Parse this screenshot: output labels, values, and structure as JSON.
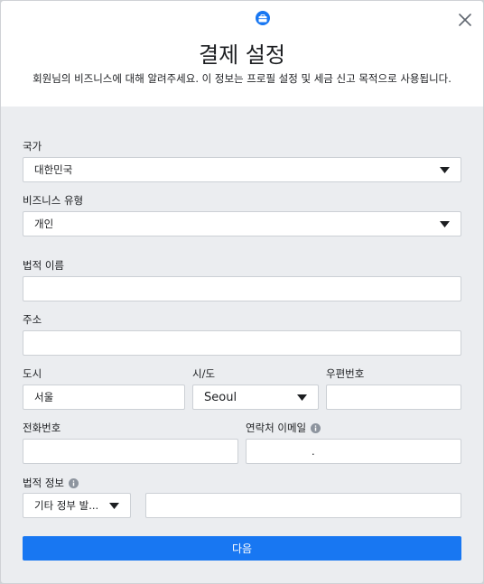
{
  "dialog": {
    "title": "결제 설정",
    "subtitle": "회원님의 비즈니스에 대해 알려주세요. 이 정보는 프로필 설정 및 세금 신고 목적으로 사용됩니다."
  },
  "form": {
    "country": {
      "label": "국가",
      "value": "대한민국"
    },
    "business_type": {
      "label": "비즈니스 유형",
      "value": "개인"
    },
    "legal_name": {
      "label": "법적 이름",
      "value": ""
    },
    "address": {
      "label": "주소",
      "value": ""
    },
    "city": {
      "label": "도시",
      "value": "서울"
    },
    "province": {
      "label": "시/도",
      "value": "Seoul"
    },
    "postal_code": {
      "label": "우편번호",
      "value": ""
    },
    "phone": {
      "label": "전화번호",
      "value": ""
    },
    "contact_email": {
      "label": "연락처 이메일",
      "value": "."
    },
    "legal_info": {
      "label": "법적 정보",
      "id_type": "기타 정부 발...",
      "value": ""
    }
  },
  "actions": {
    "next_label": "다음"
  },
  "icons": {
    "badge": "briefcase-icon",
    "close": "close-icon",
    "caret": "caret-down-icon",
    "info": "info-icon"
  },
  "colors": {
    "primary": "#1877f2",
    "body_bg": "#ebedf0",
    "border": "#ccd0d5",
    "text": "#1c1e21",
    "info_icon": "#8d949e"
  }
}
